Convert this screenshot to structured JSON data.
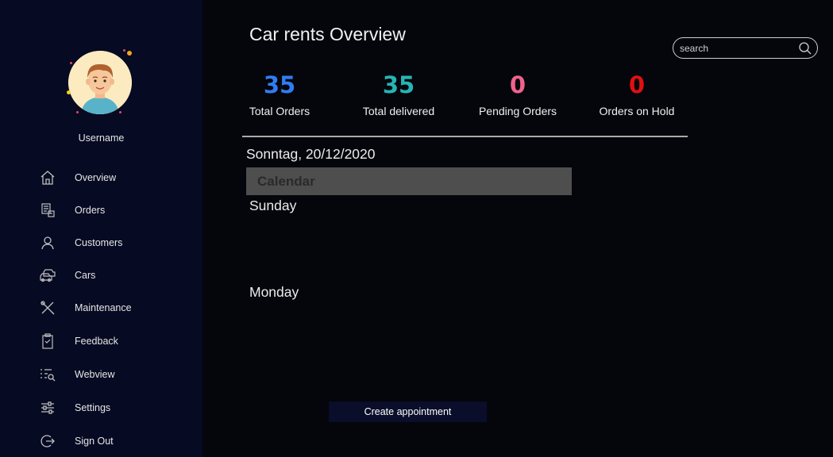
{
  "sidebar": {
    "username": "Username",
    "items": [
      {
        "label": "Overview",
        "icon": "home-icon"
      },
      {
        "label": "Orders",
        "icon": "orders-icon"
      },
      {
        "label": "Customers",
        "icon": "user-icon"
      },
      {
        "label": "Cars",
        "icon": "cars-icon"
      },
      {
        "label": "Maintenance",
        "icon": "tools-icon"
      },
      {
        "label": "Feedback",
        "icon": "clipboard-icon"
      },
      {
        "label": "Webview",
        "icon": "list-search-icon"
      },
      {
        "label": "Settings",
        "icon": "sliders-icon"
      },
      {
        "label": "Sign Out",
        "icon": "sign-out-icon"
      }
    ]
  },
  "header": {
    "title": "Car rents Overview",
    "search_placeholder": "search"
  },
  "stats": [
    {
      "value": "35",
      "label": "Total Orders",
      "color": "#2f7df2"
    },
    {
      "value": "35",
      "label": "Total delivered",
      "color": "#26b5b3"
    },
    {
      "value": "0",
      "label": "Pending Orders",
      "color": "#f0638c"
    },
    {
      "value": "0",
      "label": "Orders on Hold",
      "color": "#e01010"
    }
  ],
  "calendar": {
    "date": "Sonntag, 20/12/2020",
    "title": "Calendar",
    "days": [
      "Sunday",
      "Monday"
    ]
  },
  "actions": {
    "create_label": "Create appointment"
  }
}
